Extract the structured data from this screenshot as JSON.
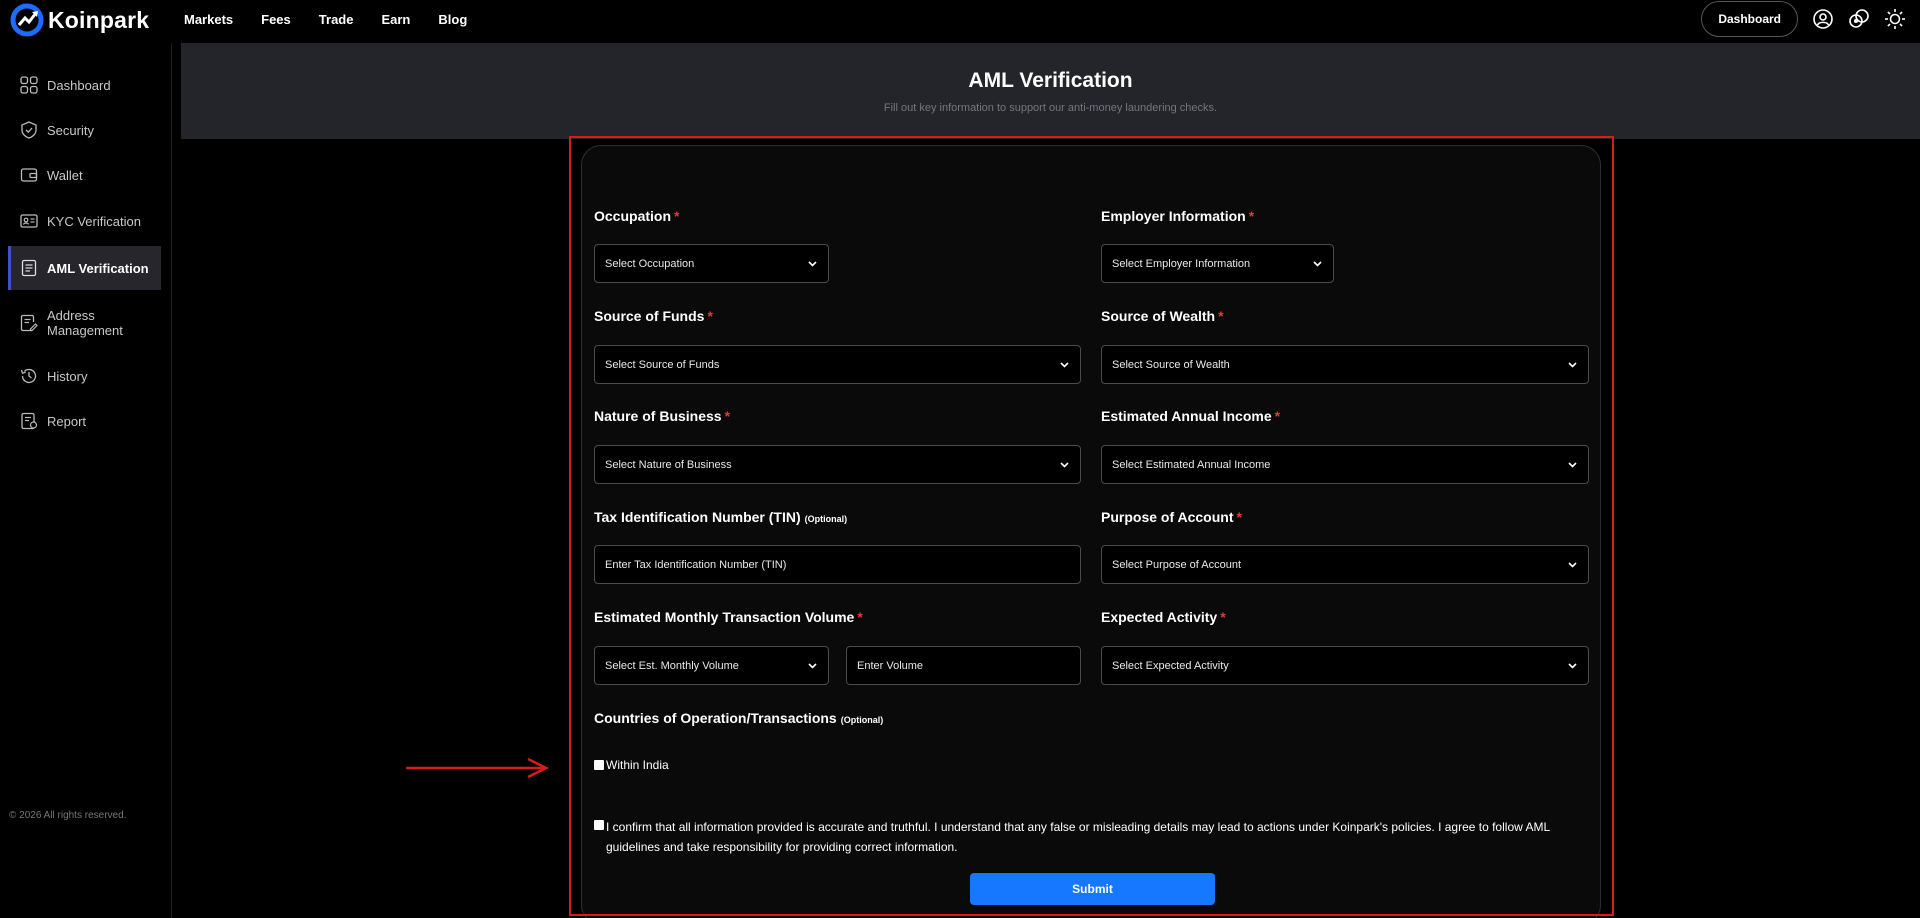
{
  "brand": {
    "name": "Koinpark"
  },
  "nav": [
    "Markets",
    "Fees",
    "Trade",
    "Earn",
    "Blog"
  ],
  "top_right": {
    "dashboard_button": "Dashboard",
    "icons": [
      "user-icon",
      "wallet-coins-icon",
      "sun-icon"
    ]
  },
  "sidebar": {
    "items": [
      {
        "label": "Dashboard",
        "icon": "grid-icon"
      },
      {
        "label": "Security",
        "icon": "shield-icon"
      },
      {
        "label": "Wallet",
        "icon": "wallet-icon"
      },
      {
        "label": "KYC Verification",
        "icon": "id-card-icon"
      },
      {
        "label": "AML Verification",
        "icon": "document-icon",
        "active": true
      },
      {
        "label": "Address Management",
        "icon": "edit-note-icon"
      },
      {
        "label": "History",
        "icon": "history-icon"
      },
      {
        "label": "Report",
        "icon": "report-icon"
      }
    ],
    "copyright": "© 2026 All rights reserved."
  },
  "header": {
    "title": "AML Verification",
    "subtitle": "Fill out key information to support our anti-money laundering checks."
  },
  "form": {
    "occupation": {
      "label": "Occupation",
      "required_mark": "*",
      "placeholder": "Select Occupation"
    },
    "employer": {
      "label": "Employer Information",
      "required_mark": "*",
      "placeholder": "Select Employer Information"
    },
    "source_of_funds": {
      "label": "Source of Funds",
      "required_mark": "*",
      "placeholder": "Select Source of Funds"
    },
    "source_of_wealth": {
      "label": "Source of Wealth",
      "required_mark": "*",
      "placeholder": "Select Source of Wealth"
    },
    "nature_of_business": {
      "label": "Nature of Business",
      "required_mark": "*",
      "placeholder": "Select Nature of Business"
    },
    "annual_income": {
      "label": "Estimated Annual Income",
      "required_mark": "*",
      "placeholder": "Select Estimated Annual Income"
    },
    "tin": {
      "label": "Tax Identification Number (TIN)",
      "optional_mark": "(Optional)",
      "placeholder": "Enter Tax Identification Number (TIN)"
    },
    "purpose": {
      "label": "Purpose of Account",
      "required_mark": "*",
      "placeholder": "Select Purpose of Account"
    },
    "monthly_volume": {
      "label": "Estimated Monthly Transaction Volume",
      "required_mark": "*",
      "select_placeholder": "Select Est. Monthly Volume",
      "input_placeholder": "Enter Volume"
    },
    "expected_activity": {
      "label": "Expected Activity",
      "required_mark": "*",
      "placeholder": "Select Expected Activity"
    },
    "countries": {
      "label": "Countries of Operation/Transactions",
      "optional_mark": "(Optional)",
      "option": "Within India"
    },
    "confirm_text": "I confirm that all information provided is accurate and truthful. I understand that any false or misleading details may lead to actions under Koinpark's policies. I agree to follow AML guidelines and take responsibility for providing correct information.",
    "submit": "Submit"
  },
  "colors": {
    "accent": "#1677ff",
    "required": "#e53935",
    "highlight": "#d81c1c",
    "active_indicator": "#3f51c9"
  }
}
